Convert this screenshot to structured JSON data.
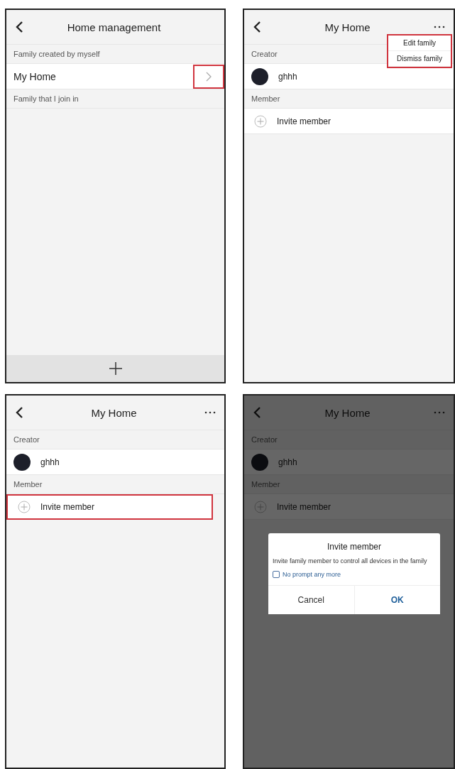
{
  "screens": [
    {
      "kind": "list",
      "title": "Home management",
      "sections": [
        {
          "header": "Family created by myself",
          "rows": [
            {
              "label": "My Home",
              "highlighted": true
            }
          ]
        },
        {
          "header": "Family that I join in"
        }
      ]
    },
    {
      "kind": "detail",
      "title": "My Home",
      "creator_label": "Creator",
      "creator_name": "ghhh",
      "member_label": "Member",
      "invite_label": "Invite member",
      "invite_highlighted": false,
      "menu": {
        "highlighted": true,
        "items": [
          "Edit family",
          "Dismiss family"
        ]
      }
    },
    {
      "kind": "detail",
      "title": "My Home",
      "creator_label": "Creator",
      "creator_name": "ghhh",
      "member_label": "Member",
      "invite_label": "Invite member",
      "invite_highlighted": true
    },
    {
      "kind": "detail",
      "title": "My Home",
      "creator_label": "Creator",
      "creator_name": "ghhh",
      "member_label": "Member",
      "invite_label": "Invite member",
      "invite_highlighted": false,
      "dialog": {
        "title": "Invite member",
        "message": "Invite family member to control all devices in the family",
        "checkbox": {
          "label": "No prompt any more",
          "checked": false
        },
        "buttons": [
          {
            "label": "Cancel",
            "kind": "cancel"
          },
          {
            "label": "OK",
            "kind": "confirm"
          }
        ]
      }
    }
  ]
}
